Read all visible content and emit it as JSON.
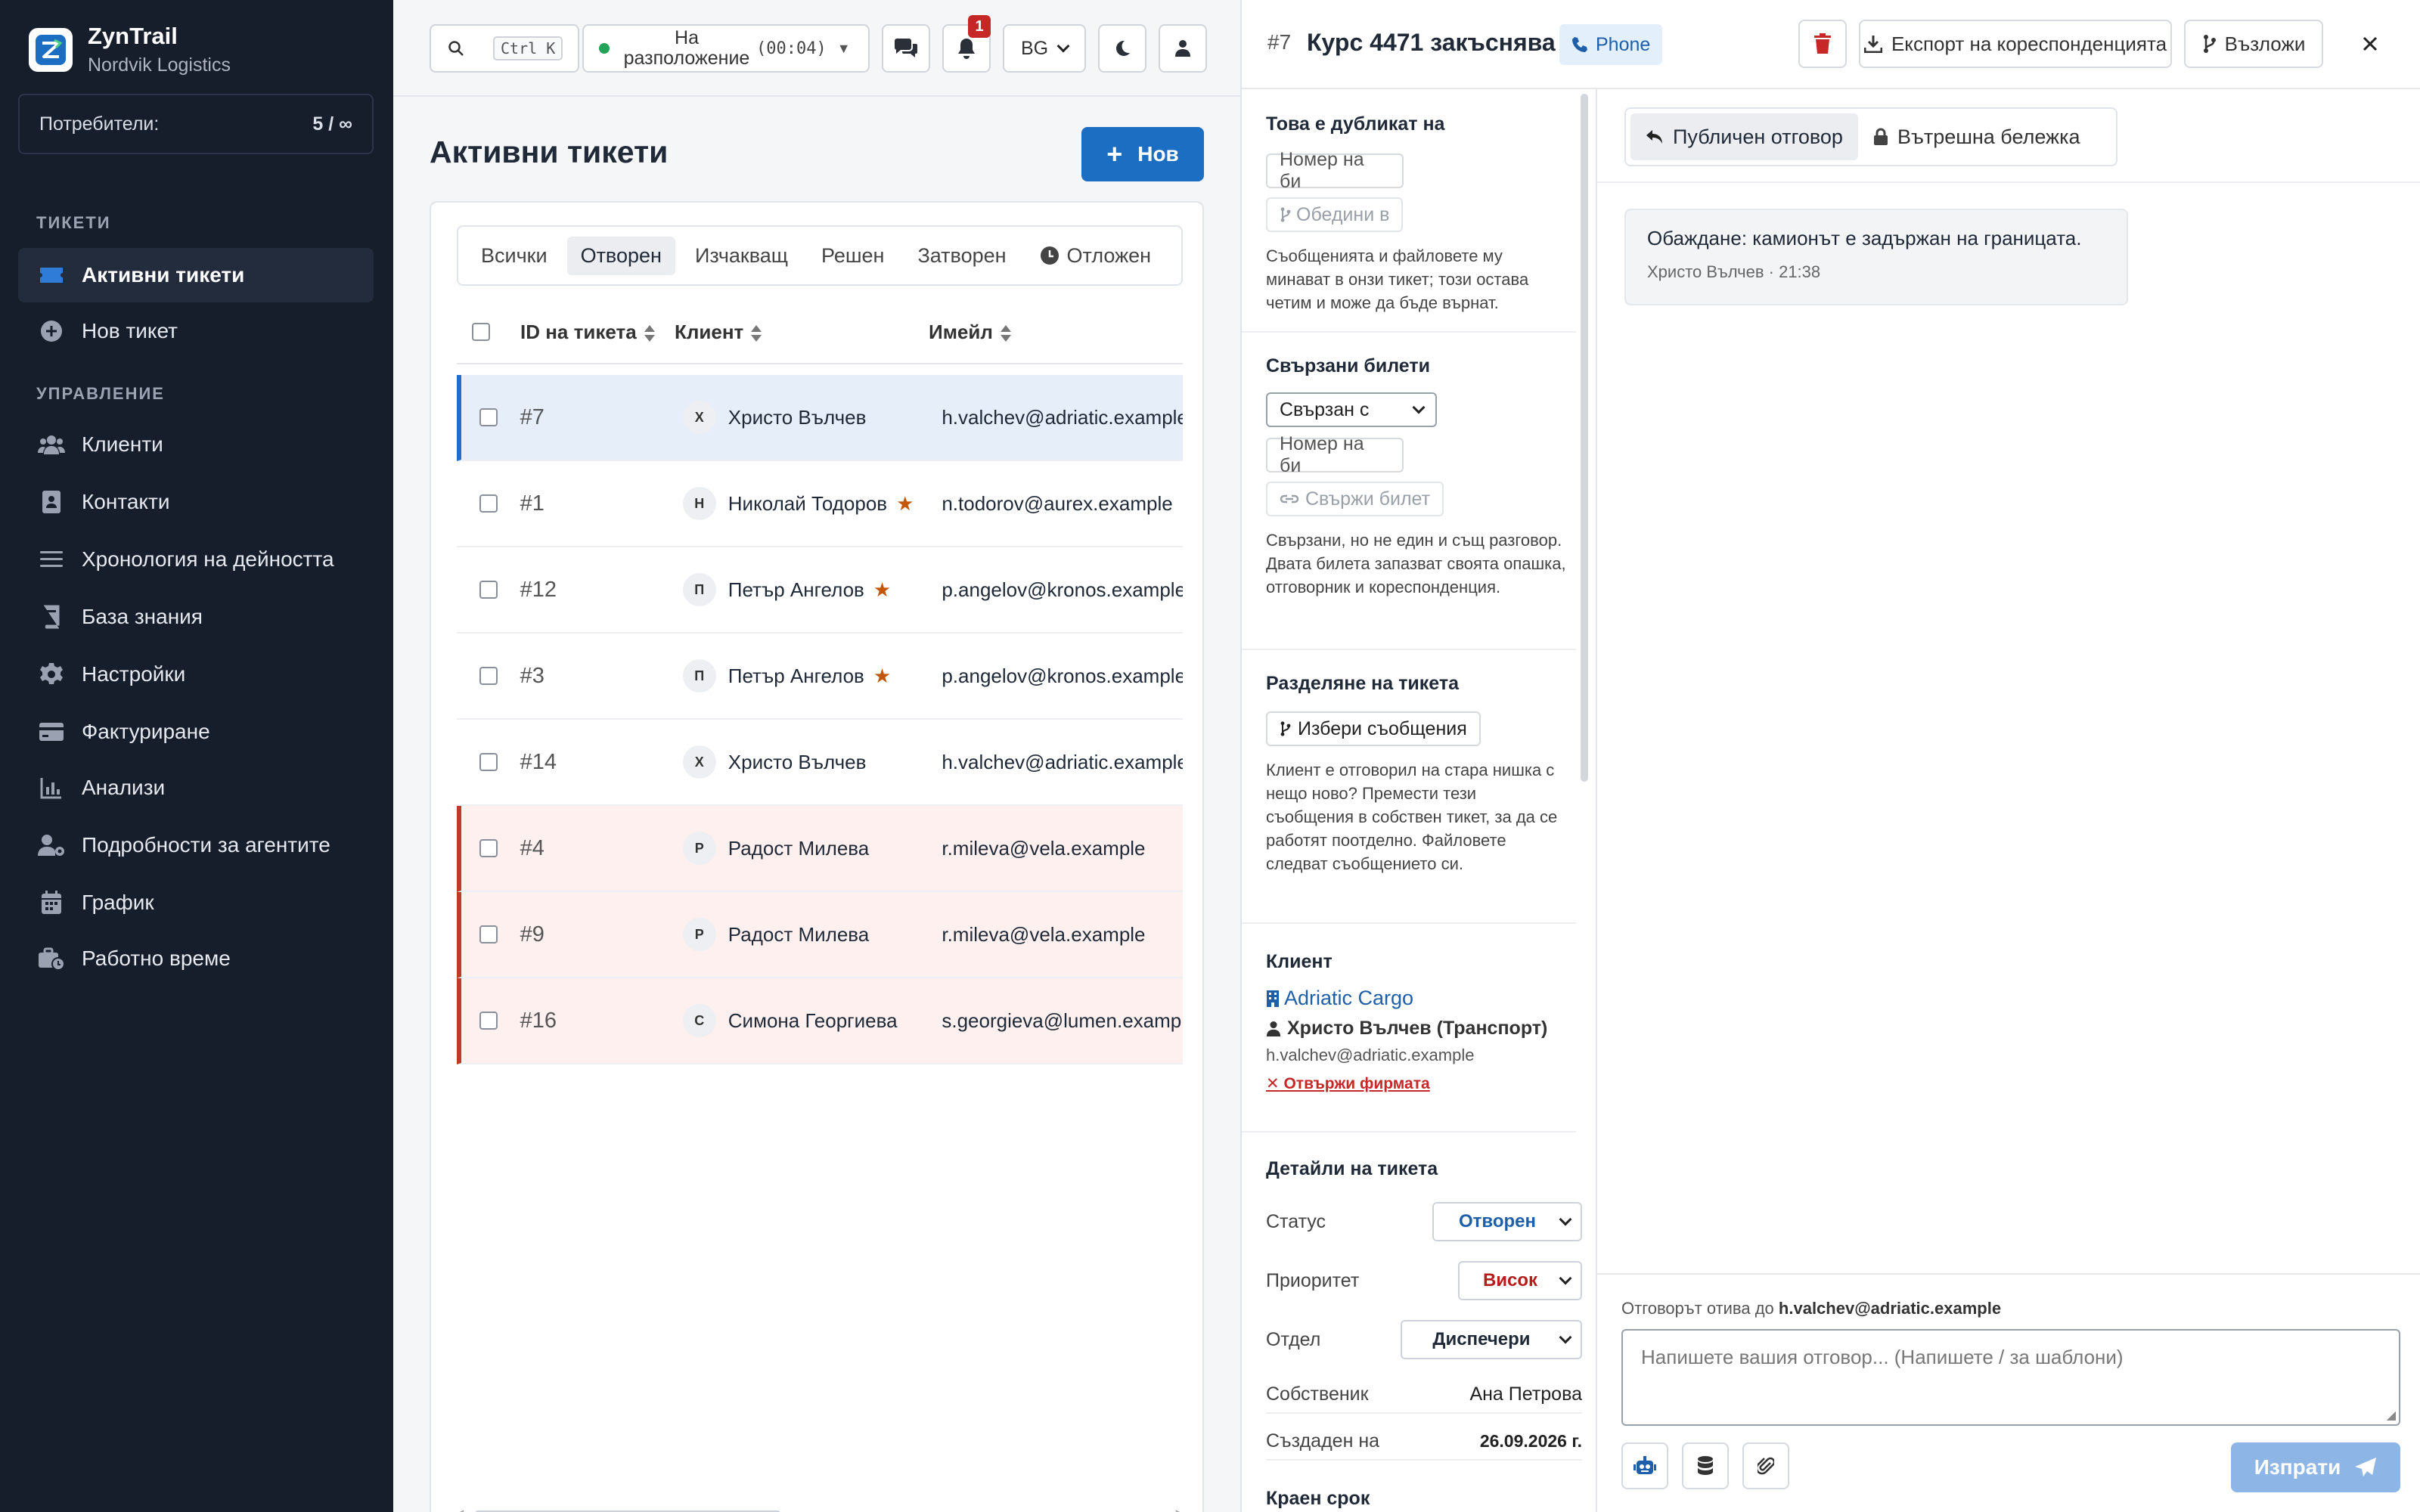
{
  "app": {
    "name": "ZynTrail",
    "org": "Nordvik Logistics"
  },
  "sidebar": {
    "users_label": "Потребители:",
    "users_value": "5 / ∞",
    "section_tickets": "ТИКЕТИ",
    "section_management": "УПРАВЛЕНИЕ",
    "items": [
      {
        "label": "Активни тикети",
        "icon": "ticket-icon"
      },
      {
        "label": "Нов тикет",
        "icon": "plus-circle-icon"
      },
      {
        "label": "Клиенти",
        "icon": "users-icon"
      },
      {
        "label": "Контакти",
        "icon": "contact-card-icon"
      },
      {
        "label": "Хронология на дейността",
        "icon": "list-icon"
      },
      {
        "label": "База знания",
        "icon": "book-icon"
      },
      {
        "label": "Настройки",
        "icon": "gear-icon"
      },
      {
        "label": "Фактуриране",
        "icon": "credit-card-icon"
      },
      {
        "label": "Анализи",
        "icon": "chart-icon"
      },
      {
        "label": "Подробности за агентите",
        "icon": "user-gear-icon"
      },
      {
        "label": "График",
        "icon": "calendar-icon"
      },
      {
        "label": "Работно време",
        "icon": "business-time-icon"
      }
    ]
  },
  "topbar": {
    "search_shortcut": "Ctrl K",
    "status_label": "На разположение",
    "status_timer": "(00:04)",
    "notifications_count": "1",
    "language": "BG"
  },
  "main": {
    "title": "Активни тикети",
    "new_button": "Нов",
    "tabs": [
      "Всички",
      "Отворен",
      "Изчакващ",
      "Решен",
      "Затворен",
      "Отложен"
    ],
    "active_tab": "Отворен",
    "columns": [
      "ID на тикета",
      "Клиент",
      "Имейл"
    ],
    "rows": [
      {
        "id": "#7",
        "initial": "Х",
        "client": "Христо Вълчев",
        "email": "h.valchev@adriatic.example",
        "vip": false,
        "state": "sel"
      },
      {
        "id": "#1",
        "initial": "Н",
        "client": "Николай Тодоров",
        "email": "n.todorov@aurex.example",
        "vip": true,
        "state": ""
      },
      {
        "id": "#12",
        "initial": "П",
        "client": "Петър Ангелов",
        "email": "p.angelov@kronos.example",
        "vip": true,
        "state": ""
      },
      {
        "id": "#3",
        "initial": "П",
        "client": "Петър Ангелов",
        "email": "p.angelov@kronos.example",
        "vip": true,
        "state": ""
      },
      {
        "id": "#14",
        "initial": "Х",
        "client": "Христо Вълчев",
        "email": "h.valchev@adriatic.example",
        "vip": false,
        "state": ""
      },
      {
        "id": "#4",
        "initial": "Р",
        "client": "Радост Милева",
        "email": "r.mileva@vela.example",
        "vip": false,
        "state": "urg"
      },
      {
        "id": "#9",
        "initial": "Р",
        "client": "Радост Милева",
        "email": "r.mileva@vela.example",
        "vip": false,
        "state": "urg"
      },
      {
        "id": "#16",
        "initial": "С",
        "client": "Симона Георгиева",
        "email": "s.georgieva@lumen.example",
        "vip": false,
        "state": "urg"
      }
    ]
  },
  "detail": {
    "ticket_number": "#7",
    "title": "Курс 4471 закъснява",
    "channel": "Phone",
    "export_label": "Експорт на кореспонденцията",
    "assign_label": "Възложи",
    "duplicate": {
      "heading": "Това е дубликат на",
      "input_placeholder": "Номер на би",
      "merge_label": "Обедини в",
      "description": "Съобщенията и файловете му минават в онзи тикет; този остава четим и може да бъде върнат."
    },
    "related": {
      "heading": "Свързани билети",
      "relation_select": "Свързан с",
      "input_placeholder": "Номер на би",
      "link_label": "Свържи билет",
      "description": "Свързани, но не един и същ разговор. Двата билета запазват своята опашка, отговорник и кореспонденция."
    },
    "split": {
      "heading": "Разделяне на тикета",
      "button": "Избери съобщения",
      "description": "Клиент е отговорил на стара нишка с нещо ново? Премести тези съобщения в собствен тикет, за да се работят поотделно. Файловете следват съобщението си."
    },
    "customer": {
      "heading": "Клиент",
      "company": "Adriatic Cargo",
      "contact": "Христо Вълчев (Транспорт)",
      "email": "h.valchev@adriatic.example",
      "unlink": "Отвържи фирмата"
    },
    "details": {
      "heading": "Детайли на тикета",
      "status_label": "Статус",
      "status_value": "Отворен",
      "priority_label": "Приоритет",
      "priority_value": "Висок",
      "department_label": "Отдел",
      "department_value": "Диспечери",
      "owner_label": "Собственик",
      "owner_value": "Ана Петрова",
      "created_label": "Създаден на",
      "created_value": "26.09.2026 г.",
      "due_label": "Краен срок"
    },
    "reply_tabs": [
      "Публичен отговор",
      "Вътрешна бележка"
    ],
    "message": {
      "text": "Обаждане: камионът е задържан на границата.",
      "meta": "Христо Вълчев · 21:38"
    },
    "composer": {
      "reply_to_prefix": "Отговорът отива до",
      "reply_to_email": "h.valchev@adriatic.example",
      "placeholder": "Напишете вашия отговор... (Напишете / за шаблони)",
      "send_label": "Изпрати"
    }
  },
  "colors": {
    "sidebar_bg": "#161d2b",
    "accent": "#1b6ec2",
    "selected_row": "#e6eef9",
    "urgent_row": "#fdf0ee",
    "urgent_border": "#c0392b",
    "vip_star": "#c2570a",
    "status_green": "#22a357",
    "badge_red": "#c62828",
    "delete_red": "#c62828"
  }
}
